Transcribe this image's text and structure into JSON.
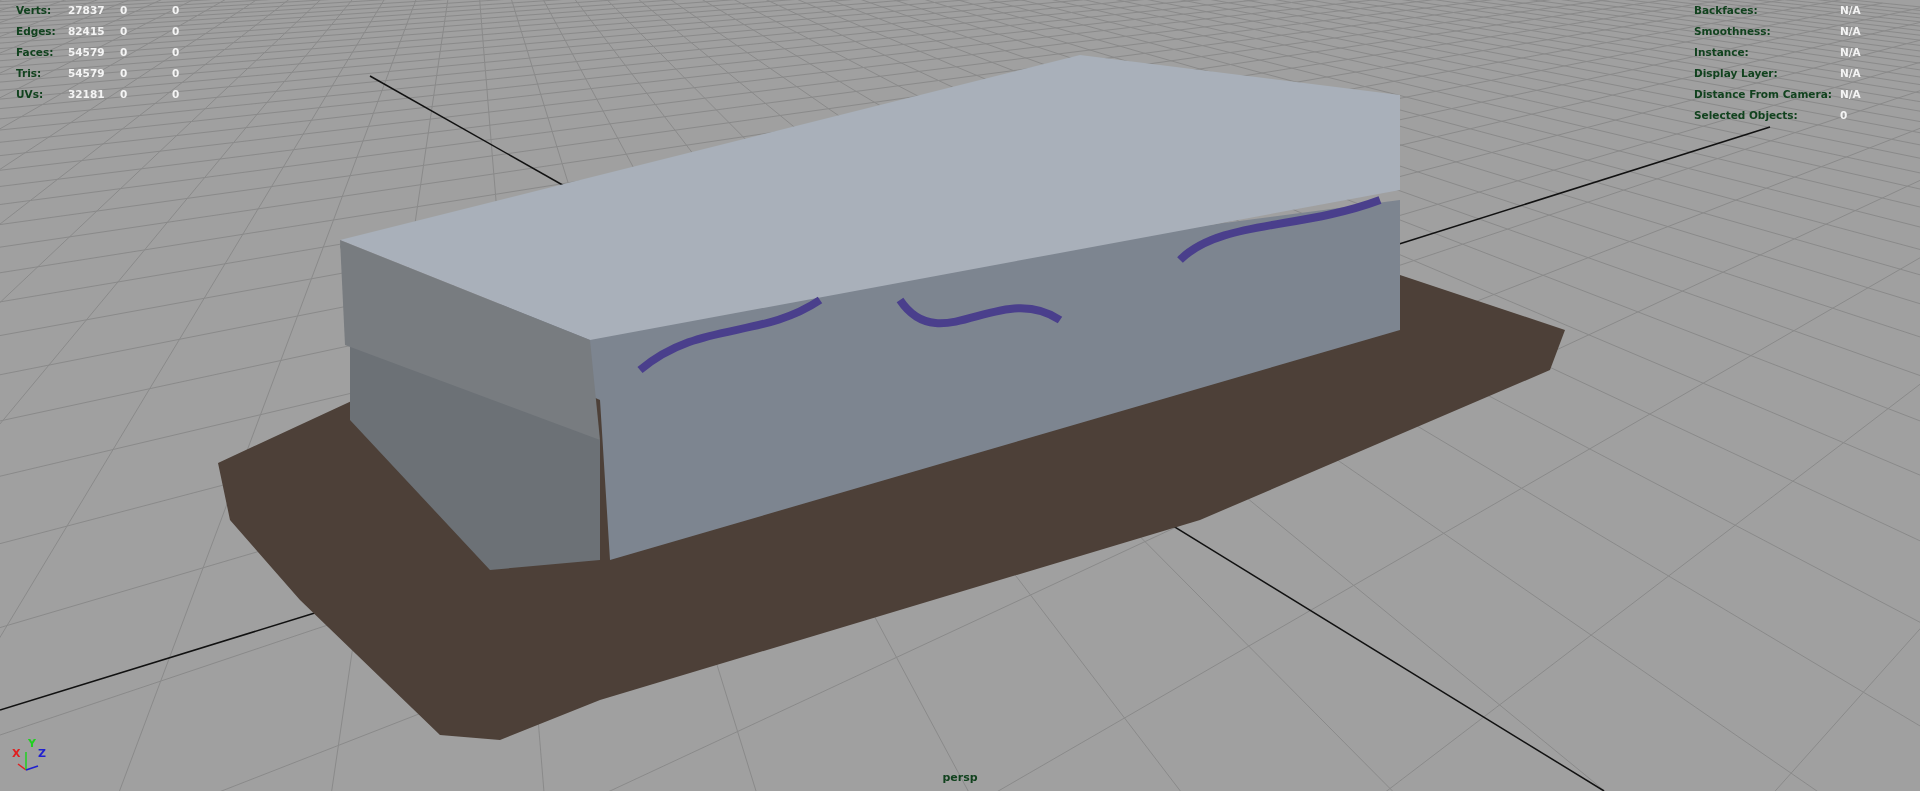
{
  "hud_left": {
    "rows": [
      {
        "label": "Verts:",
        "values": [
          "27837",
          "0",
          "0"
        ]
      },
      {
        "label": "Edges:",
        "values": [
          "82415",
          "0",
          "0"
        ]
      },
      {
        "label": "Faces:",
        "values": [
          "54579",
          "0",
          "0"
        ]
      },
      {
        "label": "Tris:",
        "values": [
          "54579",
          "0",
          "0"
        ]
      },
      {
        "label": "UVs:",
        "values": [
          "32181",
          "0",
          "0"
        ]
      }
    ]
  },
  "hud_right": {
    "rows": [
      {
        "label": "Backfaces:",
        "value": "N/A"
      },
      {
        "label": "Smoothness:",
        "value": "N/A"
      },
      {
        "label": "Instance:",
        "value": "N/A"
      },
      {
        "label": "Display Layer:",
        "value": "N/A"
      },
      {
        "label": "Distance From Camera:",
        "value": "N/A"
      },
      {
        "label": "Selected Objects:",
        "value": "0"
      }
    ]
  },
  "axis_gizmo": [
    {
      "label": "X",
      "color": "#e02020"
    },
    {
      "label": "Y",
      "color": "#20d020"
    },
    {
      "label": "Z",
      "color": "#2020d0"
    }
  ],
  "camera_label": "persp"
}
